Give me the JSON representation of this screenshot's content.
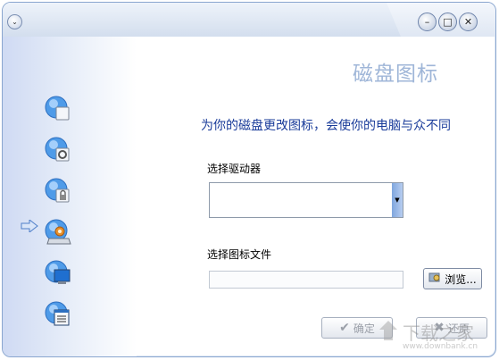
{
  "dialog": {
    "heading": "磁盘图标",
    "subtitle": "为你的磁盘更改图标，会使你的电脑与众不同"
  },
  "drive": {
    "label": "选择驱动器",
    "selected": ""
  },
  "file": {
    "label": "选择图标文件",
    "value": "",
    "browse_label": "浏览..."
  },
  "buttons": {
    "ok": "确定",
    "restore": "还原"
  },
  "nav": {
    "active_index": 3,
    "items": [
      "folder-icon",
      "folder-gear-icon",
      "folder-lock-icon",
      "disk-drive-icon",
      "monitor-icon",
      "window-list-icon"
    ]
  },
  "watermark": {
    "text": "下载之家",
    "url": "www.downbank.cn"
  },
  "colors": {
    "heading": "#9fb6d8",
    "subtitle": "#1a3c9a",
    "accent": "#7fa6de"
  }
}
